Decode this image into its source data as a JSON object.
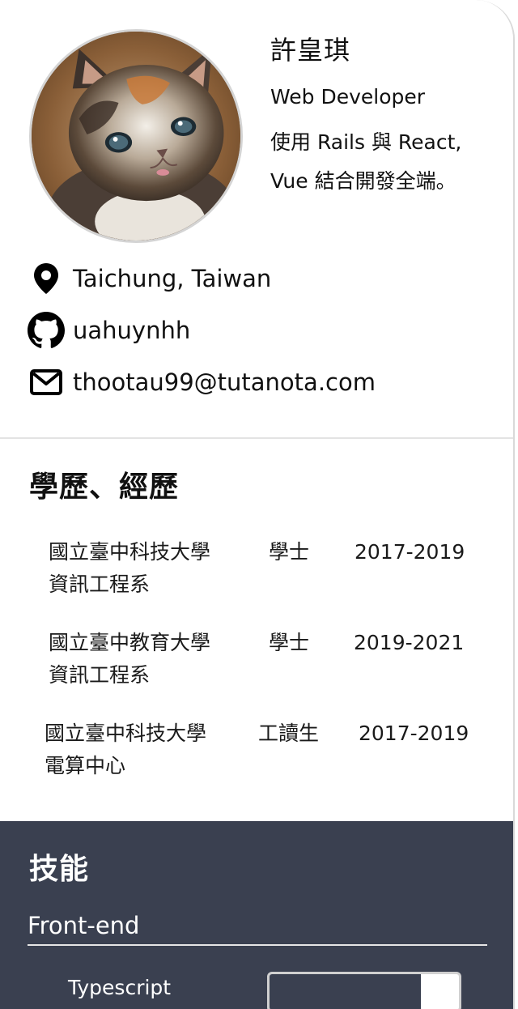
{
  "profile": {
    "name": "許皇琪",
    "role": "Web Developer",
    "bio": "使用 Rails 與 React, Vue 結合開發全端。",
    "avatar_icon": "kitten-photo"
  },
  "contacts": {
    "location": "Taichung, Taiwan",
    "github": "uahuynhh",
    "email": "thootau99@tutanota.com"
  },
  "education": {
    "title": "學歷、經歷",
    "items": [
      {
        "school": "國立臺中科技大學",
        "department": "資訊工程系",
        "degree": "學士",
        "years": "2017-2019"
      },
      {
        "school": "國立臺中教育大學",
        "department": "資訊工程系",
        "degree": "學士",
        "years": "2019-2021"
      },
      {
        "school": "國立臺中科技大學",
        "department": "電算中心",
        "degree": "工讀生",
        "years": "2017-2019"
      }
    ]
  },
  "skills": {
    "title": "技能",
    "background_color": "#3a4050",
    "categories": [
      {
        "name": "Front-end",
        "items": [
          {
            "name": "Typescript",
            "level": 0.8
          }
        ]
      }
    ]
  }
}
